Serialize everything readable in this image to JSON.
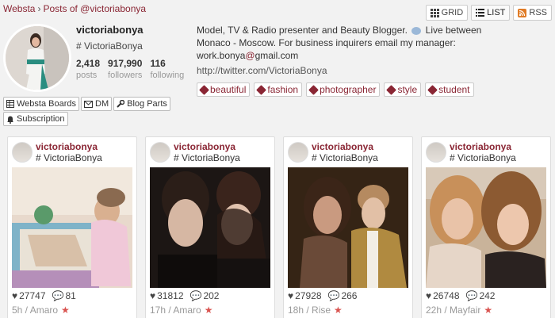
{
  "breadcrumb": {
    "home": "Websta",
    "current": "Posts of @victoriabonya"
  },
  "view": {
    "grid": "GRID",
    "list": "LIST",
    "rss": "RSS"
  },
  "profile": {
    "username": "victoriabonya",
    "fullname": "# VictoriaBonya",
    "stats": [
      {
        "num": "2,418",
        "label": "posts"
      },
      {
        "num": "917,990",
        "label": "followers"
      },
      {
        "num": "116",
        "label": "following"
      }
    ]
  },
  "bio": {
    "text1": "Model, TV & Radio presenter and Beauty Blogger.",
    "text2": "Live between Monaco - Moscow. For business inquirers email my manager: work.bonya",
    "email_at": "@",
    "email_domain": "gmail.com",
    "twitter": "http://twitter.com/VictoriaBonya"
  },
  "tags": [
    "beautiful",
    "fashion",
    "photographer",
    "style",
    "student"
  ],
  "actions": {
    "boards": "Websta Boards",
    "dm": "DM",
    "blog": "Blog Parts",
    "subscription": "Subscription"
  },
  "posts": [
    {
      "user": "victoriabonya",
      "hash": "# VictoriaBonya",
      "likes": "27747",
      "comments": "81",
      "time": "5h / Amaro"
    },
    {
      "user": "victoriabonya",
      "hash": "# VictoriaBonya",
      "likes": "31812",
      "comments": "202",
      "time": "17h / Amaro"
    },
    {
      "user": "victoriabonya",
      "hash": "# VictoriaBonya",
      "likes": "27928",
      "comments": "266",
      "time": "18h / Rise"
    },
    {
      "user": "victoriabonya",
      "hash": "# VictoriaBonya",
      "likes": "26748",
      "comments": "242",
      "time": "22h / Mayfair"
    }
  ],
  "colors": {
    "accent": "#8a2634",
    "star": "#d9534f",
    "rss": "#e07b25"
  }
}
